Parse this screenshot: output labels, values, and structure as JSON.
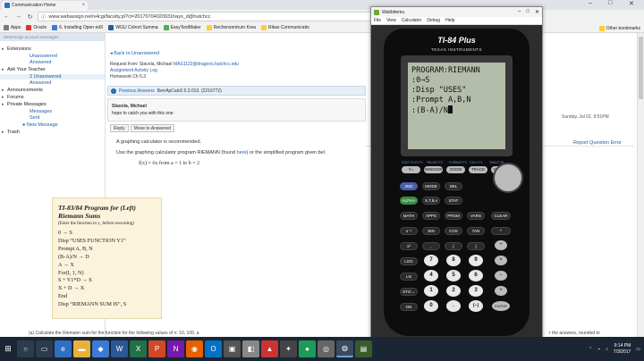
{
  "browser": {
    "tab_title": "Communication Home",
    "url": "www.webassign.net/v4cgi/faculty.pl?ci=20170704020931hays_d@hutchcc",
    "bookmarks": [
      "Apps",
      "Oracle",
      "6. Installing Open edX",
      "WGU Cohort Summa",
      "EasyTestMaker",
      "Rechenzentrum Krea",
      "Rikas Communicatio"
    ],
    "other_bookmarks": "Other bookmarks"
  },
  "sidebar": {
    "top_text": "WebAssign account messages",
    "sections": [
      {
        "label": "Extensions",
        "items": [
          "Unanswered",
          "Answered"
        ]
      },
      {
        "label": "Ask Your Teacher",
        "items": [
          "2 Unanswered",
          "Answered"
        ]
      },
      {
        "label": "Announcements",
        "items": []
      },
      {
        "label": "Forums",
        "items": []
      },
      {
        "label": "Private Messages",
        "items": [
          "Messages",
          "Sent",
          "New Message"
        ]
      },
      {
        "label": "Trash",
        "items": []
      }
    ]
  },
  "main": {
    "back_link": "Back to Unanswered",
    "request_from_label": "Request from:",
    "request_from_name": "Stavola, Michael",
    "request_from_email": "MAS1123@dragons.hutchcc.edu",
    "activity_log": "Assignment Activity Log",
    "homework": "Homework Ch 5.3",
    "prev_answers": "Previous Answers",
    "question_ref": "BerrApCalc6 5.3.013. (2216772)",
    "msg_author": "Stavola, Michael",
    "msg_text": "hope to catch you with this one",
    "msg_date": "Sunday, Jul 02, 9:51PM",
    "btn_reply": "Reply",
    "btn_move": "Move to Answered",
    "report_link": "Report Question Error",
    "p1": "A graphing calculator is recommended.",
    "p2_a": "Use the graphing calculator program RIEMANN (found ",
    "p2_link": "here",
    "p2_b": ") or the simplified program given bel",
    "formula": "f(x) = 6x  from  a = 1  to  b = 2",
    "program": {
      "title": "TI-83/84 Program for (Left) Riemann Sums",
      "subtitle": "(Enter the function in y₁ before executing)",
      "lines": [
        "0 → S",
        "Disp “USES FUNCTION Y1”",
        "Prompt A, B, N",
        "(B-A)/N → D",
        "A → X",
        "For(I, 1, N)",
        "S + Y1*D → S",
        "X + D → X",
        "End",
        "Disp “RIEMANN SUM IS”, S"
      ]
    },
    "bottom_question": "(a) Calculate the Riemann sum for the function for the following values of n: 10, 100, a",
    "right_snip": "r the answers, rounded to"
  },
  "emulator": {
    "window_title": "Wabbitemu",
    "menu": [
      "File",
      "View",
      "Calculator",
      "Debug",
      "Help"
    ],
    "model": "TI-84 Plus",
    "brand": "TEXAS INSTRUMENTS",
    "screen_lines": [
      "PROGRAM:RIEMANN",
      ":0→S",
      ":Disp \"USES\"",
      ":Prompt A,B,N",
      ":(B-A)/N"
    ]
  },
  "keys": {
    "row1": [
      "Y=",
      "WINDOW",
      "ZOOM",
      "TRACE",
      "GRAPH"
    ],
    "row1_above": [
      "STAT PLOT F1",
      "TBLSET F2",
      "FORMAT F3",
      "CALC F4",
      "TABLE F5"
    ],
    "row2": [
      "2ND",
      "MODE",
      "DEL"
    ],
    "row3": [
      "ALPHA",
      "X,T,θ,n",
      "STAT"
    ],
    "row4": [
      "MATH",
      "APPS",
      "PRGM",
      "VARS",
      "CLEAR"
    ],
    "row5": [
      "x⁻¹",
      "SIN",
      "COS",
      "TAN",
      "^"
    ],
    "row6": [
      "x²",
      ",",
      "(",
      ")",
      "÷"
    ],
    "row7": [
      "LOG",
      "7",
      "8",
      "9",
      "×"
    ],
    "row8": [
      "LN",
      "4",
      "5",
      "6",
      "−"
    ],
    "row9": [
      "STO→",
      "1",
      "2",
      "3",
      "+"
    ],
    "row10": [
      "ON",
      "0",
      ".",
      "(−)",
      "ENTER"
    ]
  },
  "taskbar": {
    "time": "9:14 PM",
    "date": "7/3/2017"
  }
}
